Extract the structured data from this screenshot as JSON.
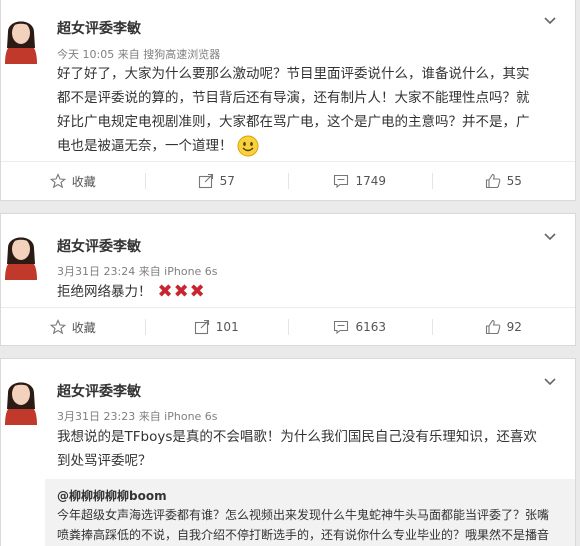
{
  "posts": [
    {
      "name": "超女评委李敏",
      "meta": "今天 10:05 来自 搜狗高速浏览器",
      "lines": [
        "好了好了，大家为什么要那么激动呢？节目里面评委说什么，谁备说什么，其实",
        "都不是评委说的算的，节目背后还有导演，还有制片人！大家不能理性点吗？就",
        "好比广电规定电视剧准则，大家都在骂广电，这个是广电的主意吗？并不是，广",
        "电也是被逼无奈，一个道理！"
      ],
      "actions": {
        "favorite": "收藏",
        "forward": "57",
        "comment": "1749",
        "like": "55"
      }
    },
    {
      "name": "超女评委李敏",
      "meta": "3月31日 23:24 来自 iPhone 6s",
      "text": "拒绝网络暴力！",
      "crosses": "✖✖✖",
      "actions": {
        "favorite": "收藏",
        "forward": "101",
        "comment": "6163",
        "like": "92"
      }
    },
    {
      "name": "超女评委李敏",
      "meta": "3月31日 23:23 来自 iPhone 6s",
      "lines": [
        "我想说的是TFboys是真的不会唱歌！为什么我们国民自己没有乐理知识，还喜欢",
        "到处骂评委呢？"
      ],
      "quote": {
        "name": "@柳柳柳柳柳boom",
        "lines": [
          "今年超级女声海选评委都有谁？怎么视频出来发现什么牛鬼蛇神牛头马面都能当评委了？张嘴",
          "喷粪捧高踩低的不说，自我介绍不停打断选手的，还有说你什么专业毕业的？哦果然不是播音"
        ]
      }
    }
  ],
  "colors": {
    "cross": "#c9252f",
    "meta": "#808080",
    "text": "#333333"
  }
}
